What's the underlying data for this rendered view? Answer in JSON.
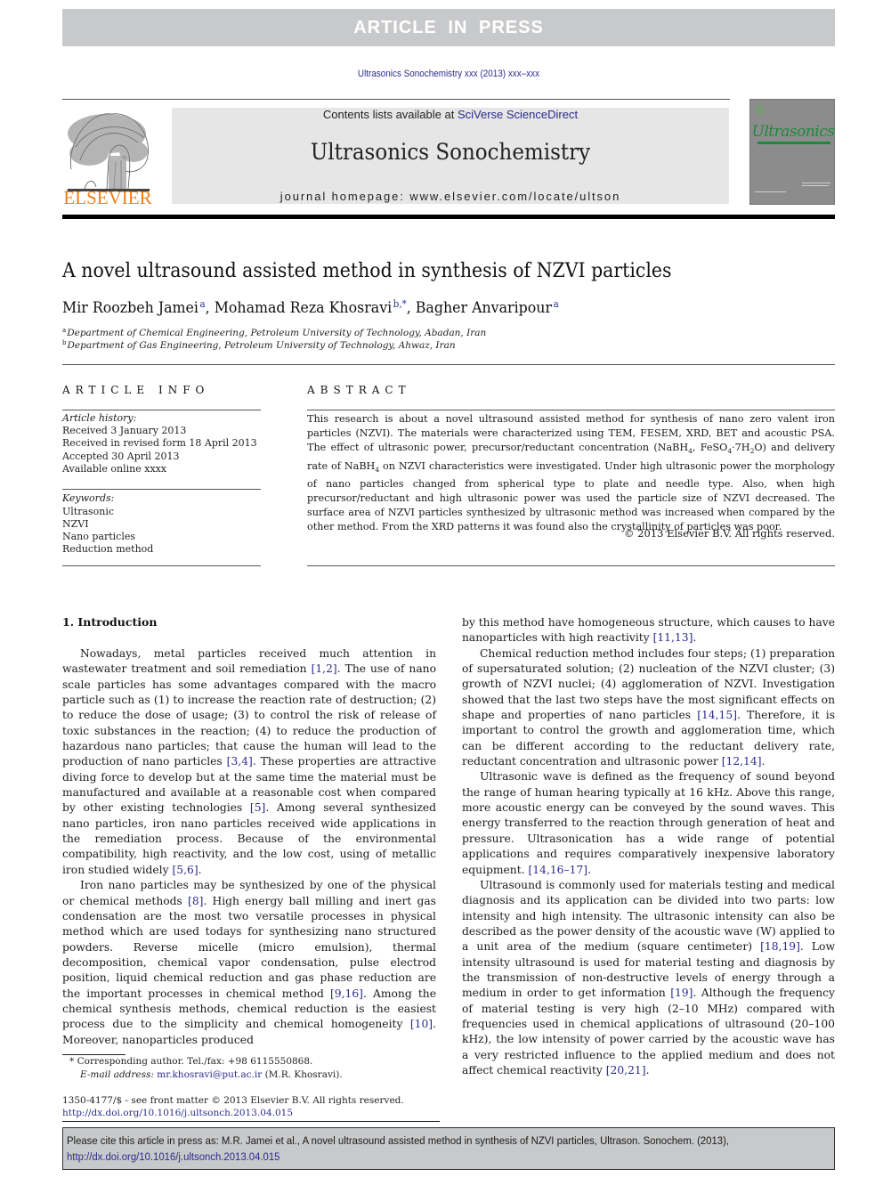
{
  "banner": {
    "label": "ARTICLE IN PRESS"
  },
  "journal_ref": "Ultrasonics Sonochemistry xxx (2013) xxx–xxx",
  "masthead": {
    "publisher_logo_text": "ELSEVIER",
    "contents_prefix": "Contents lists available at ",
    "contents_link": "SciVerse ScienceDirect",
    "journal_title": "Ultrasonics Sonochemistry",
    "homepage_label": "journal homepage: ",
    "homepage_url": "www.elsevier.com/locate/ultson",
    "cover_title": "Ultrasonics"
  },
  "colors": {
    "banner_gray": "#c8c9cb",
    "masthead_gray": "#e6e6e6",
    "link_blue": "#2b2b8f",
    "elsevier_orange": "#f07f1a",
    "cover_green": "#1b8a3a"
  },
  "article": {
    "title": "A novel ultrasound assisted method in synthesis of NZVI particles",
    "authors": [
      {
        "name": "Mir Roozbeh Jamei",
        "sup": "a"
      },
      {
        "name": "Mohamad Reza Khosravi",
        "sup": "b,*"
      },
      {
        "name": "Bagher Anvaripour",
        "sup": "a"
      }
    ],
    "affiliations": [
      {
        "sup": "a",
        "text": "Department of Chemical Engineering, Petroleum University of Technology, Abadan, Iran"
      },
      {
        "sup": "b",
        "text": "Department of Gas Engineering, Petroleum University of Technology, Ahwaz, Iran"
      }
    ]
  },
  "article_info": {
    "heading": "ARTICLE INFO",
    "history_label": "Article history:",
    "history": [
      "Received 3 January 2013",
      "Received in revised form 18 April 2013",
      "Accepted 30 April 2013",
      "Available online xxxx"
    ],
    "keywords_label": "Keywords:",
    "keywords": [
      "Ultrasonic",
      "NZVI",
      "Nano particles",
      "Reduction method"
    ]
  },
  "abstract": {
    "heading": "ABSTRACT",
    "p1": "This research is about a novel ultrasound assisted method for synthesis of nano zero valent iron particles (NZVI). The materials were characterized using TEM, FESEM, XRD, BET and acoustic PSA. The effect of ultrasonic power, precursor/reductant concentration (NaBH",
    "sub1": "4",
    "p2": ", FeSO",
    "sub2": "4",
    "p3": "·7H",
    "sub3": "2",
    "p4": "O) and delivery rate of NaBH",
    "sub4": "4",
    "p5": " on NZVI characteristics were investigated. Under high ultrasonic power the morphology of nano particles changed from spherical type to plate and needle type. Also, when high precursor/reductant and high ultrasonic power was used the particle size of NZVI decreased. The surface area of NZVI particles synthesized by ultrasonic method was increased when compared by the other method. From the XRD patterns it was found also the crystallinity of particles was poor.",
    "copyright": "© 2013 Elsevier B.V. All rights reserved."
  },
  "body": {
    "section_heading": "1. Introduction",
    "left": {
      "p1a": "Nowadays, metal particles received much attention in wastewater treatment and soil remediation ",
      "p1r1": "[1,2]",
      "p1b": ". The use of nano scale particles has some advantages compared with the macro particle such as (1) to increase the reaction rate of destruction; (2) to reduce the dose of usage; (3) to control the risk of release of toxic substances in the reaction; (4) to reduce the production of hazardous nano particles; that cause the human will lead to the production of nano particles ",
      "p1r2": "[3,4]",
      "p1c": ". These properties are attractive diving force to develop but at the same time the material must be manufactured and available at a reasonable cost when compared by other existing technologies ",
      "p1r3": "[5]",
      "p1d": ". Among several synthesized nano particles, iron nano particles received wide applications in the remediation process. Because of the environmental compatibility, high reactivity, and the low cost, using of metallic iron studied widely ",
      "p1r4": "[5,6]",
      "p1e": ".",
      "p2a": "Iron nano particles may be synthesized by one of the physical or chemical methods ",
      "p2r1": "[8]",
      "p2b": ". High energy ball milling and inert gas condensation are the most two versatile processes in physical method which are used todays for synthesizing nano structured powders. Reverse micelle (micro emulsion), thermal decomposition, chemical vapor condensation, pulse electrod position, liquid chemical reduction and gas phase reduction are the important processes in chemical method ",
      "p2r2": "[9,16]",
      "p2c": ". Among the chemical synthesis methods, chemical reduction is the easiest process due to the simplicity and chemical homogeneity ",
      "p2r3": "[10]",
      "p2d": ". Moreover, nanoparticles produced"
    },
    "right": {
      "p0a": "by this method have homogeneous structure, which causes to have nanoparticles with high reactivity ",
      "p0r1": "[11,13]",
      "p0b": ".",
      "p1a": "Chemical reduction method includes four steps; (1) preparation of supersaturated solution; (2) nucleation of the NZVI cluster; (3) growth of NZVI nuclei; (4) agglomeration of NZVI. Investigation showed that the last two steps have the most significant effects on shape and properties of nano particles ",
      "p1r1": "[14,15]",
      "p1b": ". Therefore, it is important to control the growth and agglomeration time, which can be different according to the reductant delivery rate, reductant concentration and ultrasonic power ",
      "p1r2": "[12,14]",
      "p1c": ".",
      "p2a": "Ultrasonic wave is defined as the frequency of sound beyond the range of human hearing typically at 16 kHz. Above this range, more acoustic energy can be conveyed by the sound waves. This energy transferred to the reaction through generation of heat and pressure. Ultrasonication has a wide range of potential applications and requires comparatively inexpensive laboratory equipment. ",
      "p2r1": "[14,16–17]",
      "p2b": ".",
      "p3a": "Ultrasound is commonly used for materials testing and medical diagnosis and its application can be divided into two parts: low intensity and high intensity. The ultrasonic intensity can also be described as the power density of the acoustic wave (W) applied to a unit area of the medium (square centimeter) ",
      "p3r1": "[18,19]",
      "p3b": ". Low intensity ultrasound is used for material testing and diagnosis by the transmission of non-destructive levels of energy through a medium in order to get information ",
      "p3r2": "[19]",
      "p3c": ". Although the frequency of material testing is very high (2–10 MHz) compared with frequencies used in chemical applications of ultrasound (20–100 kHz), the low intensity of power carried by the acoustic wave has a very restricted influence to the applied medium and does not affect chemical reactivity ",
      "p3r3": "[20,21]",
      "p3d": "."
    }
  },
  "footnotes": {
    "corresponding": "* Corresponding author. Tel./fax: +98 6115550868.",
    "email_label": "E-mail address: ",
    "email": "mr.khosravi@put.ac.ir",
    "email_suffix": " (M.R. Khosravi).",
    "issn": "1350-4177/$ - see front matter © 2013 Elsevier B.V. All rights reserved.",
    "doi": "http://dx.doi.org/10.1016/j.ultsonch.2013.04.015"
  },
  "citation_box": {
    "text": "Please cite this article in press as: M.R. Jamei et al., A novel ultrasound assisted method in synthesis of NZVI particles, Ultrason. Sonochem. (2013), ",
    "link": "http://dx.doi.org/10.1016/j.ultsonch.2013.04.015"
  }
}
